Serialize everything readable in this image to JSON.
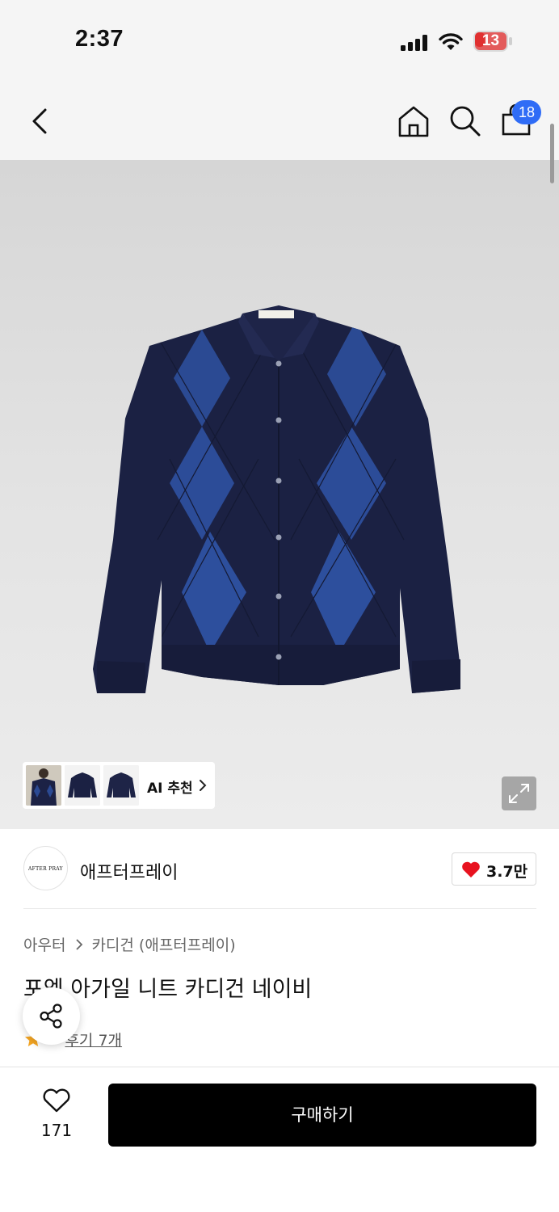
{
  "status_bar": {
    "time": "2:37",
    "battery": "13"
  },
  "nav": {
    "cart_count": "18"
  },
  "gallery": {
    "ai_recommend_label": "AI 추천"
  },
  "brand": {
    "logo_text": "AFTER PRAY",
    "name": "애프터프레이",
    "likes": "3.7만"
  },
  "breadcrumb": {
    "category": "아우터",
    "subcategory": "카디건 (애프터프레이)"
  },
  "product": {
    "title": "포엠 아가일 니트 카디건 네이비",
    "rating": "5",
    "review_link": "후기 7개"
  },
  "bottom_bar": {
    "wish_count": "171",
    "buy_label": "구매하기"
  },
  "colors": {
    "badge": "#2f6cf6",
    "heart": "#e8121f",
    "star": "#f5a623",
    "buy_button": "#000000"
  }
}
